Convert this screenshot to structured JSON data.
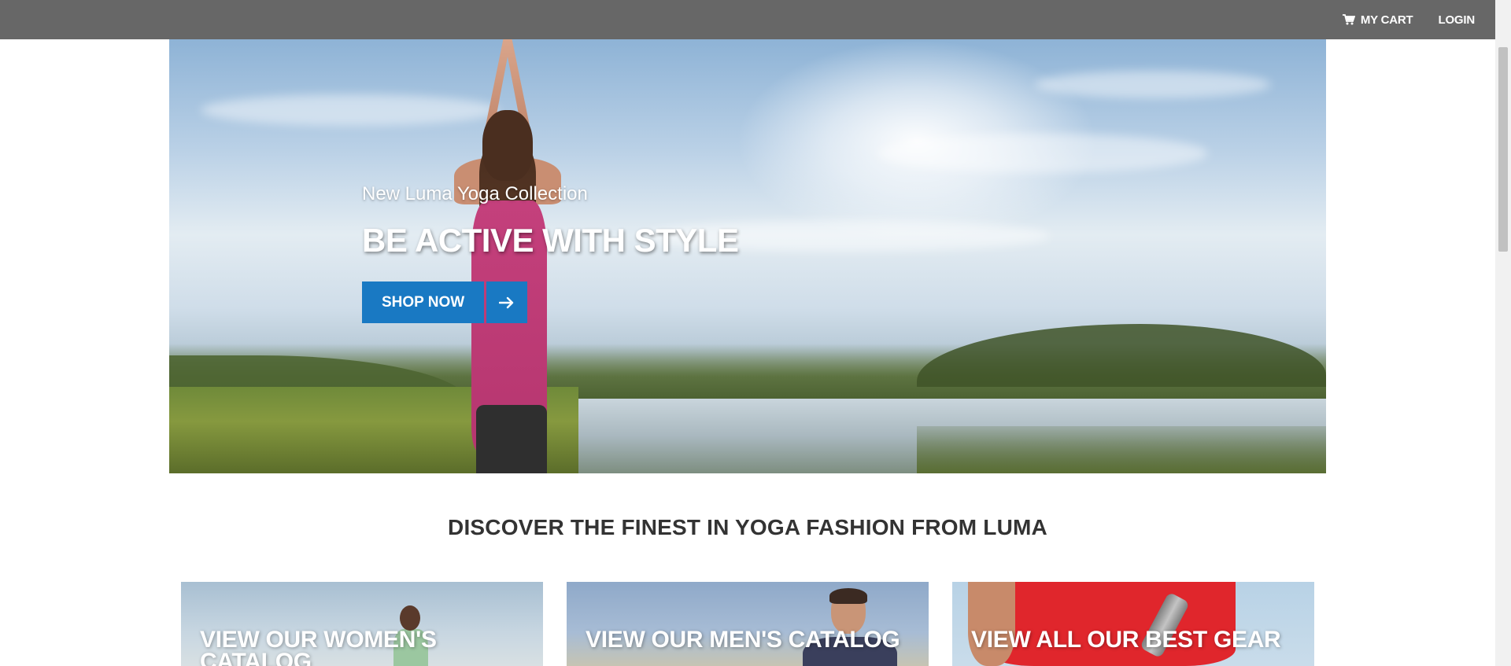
{
  "header": {
    "cart_label": "MY CART",
    "login_label": "LOGIN",
    "cart_icon": "cart-icon",
    "bg_color": "#676767"
  },
  "hero": {
    "subtitle": "New Luma Yoga Collection",
    "title": "BE ACTIVE WITH STYLE",
    "cta_label": "SHOP NOW",
    "cta_icon": "arrow-right-icon",
    "cta_color": "#1979c3"
  },
  "section": {
    "title": "DISCOVER THE FINEST IN YOGA FASHION FROM LUMA"
  },
  "catalog": [
    {
      "label": "VIEW OUR WOMEN'S CATALOG"
    },
    {
      "label": "VIEW OUR MEN'S CATALOG"
    },
    {
      "label": "VIEW ALL OUR BEST GEAR"
    }
  ]
}
